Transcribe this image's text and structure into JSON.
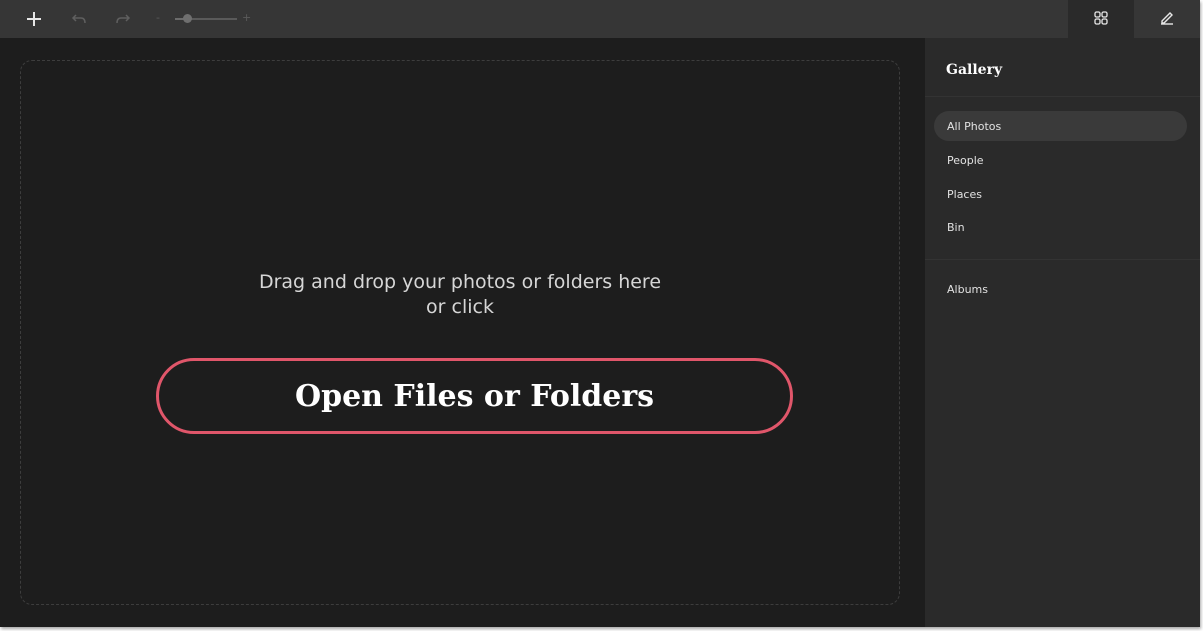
{
  "toolbar": {
    "icons": {
      "add": "plus-icon",
      "undo": "undo-icon",
      "redo": "redo-icon",
      "grid": "grid-icon",
      "edit": "pencil-icon"
    },
    "zoom": {
      "minus_label": "-",
      "plus_label": "+",
      "level": 0.2
    }
  },
  "main": {
    "drop_text_line1": "Drag and drop your photos or folders here",
    "drop_text_line2": "or click",
    "open_button_label": "Open Files or Folders"
  },
  "sidebar": {
    "title": "Gallery",
    "items": [
      {
        "label": "All Photos",
        "active": true
      },
      {
        "label": "People",
        "active": false
      },
      {
        "label": "Places",
        "active": false
      },
      {
        "label": "Bin",
        "active": false
      }
    ],
    "albums_label": "Albums"
  },
  "colors": {
    "accent": "#e0566a",
    "toolbar_bg": "#363636",
    "main_bg": "#1d1d1d",
    "sidebar_bg": "#2a2a2a"
  }
}
